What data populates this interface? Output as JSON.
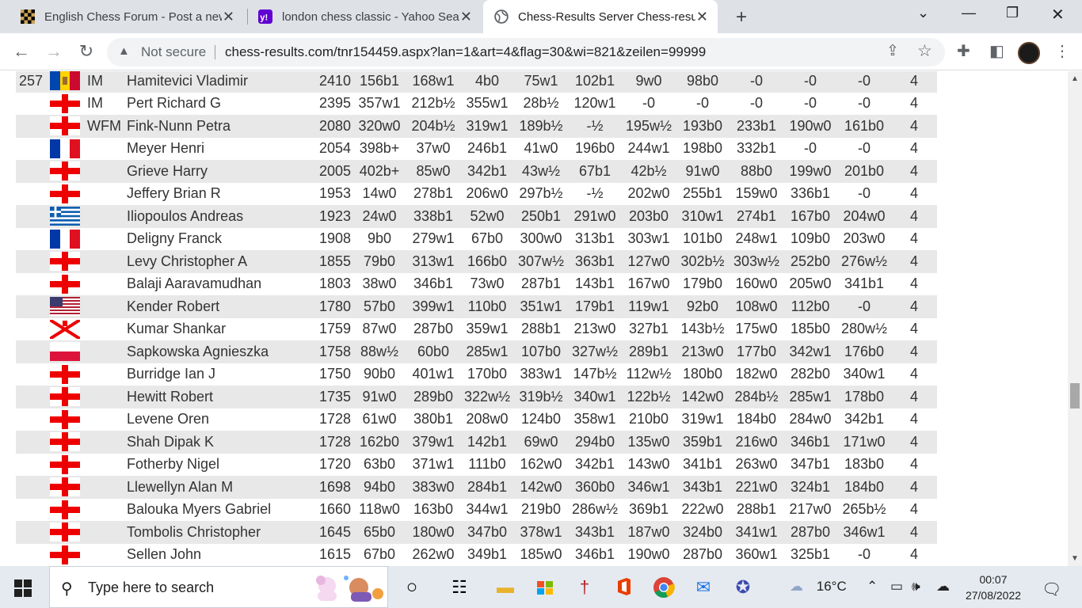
{
  "browser": {
    "tabs": [
      {
        "title": "English Chess Forum - Post a new",
        "favicon": "chessboard-icon"
      },
      {
        "title": "london chess classic - Yahoo Sear",
        "favicon": "yahoo-icon"
      },
      {
        "title": "Chess-Results Server Chess-result",
        "favicon": "globe-icon",
        "active": true
      }
    ],
    "address": {
      "security": "Not secure",
      "url": "chess-results.com/tnr154459.aspx?lan=1&art=4&flag=30&wi=821&zeilen=99999"
    }
  },
  "results": {
    "rows": [
      {
        "rank": "257",
        "flag": "MDA",
        "title": "IM",
        "name": "Hamitevici Vladimir",
        "rating": "2410",
        "rounds": [
          "156b1",
          "168w1",
          "4b0",
          "75w1",
          "102b1",
          "9w0",
          "98b0",
          "-0",
          "-0",
          "-0"
        ],
        "pts": "4"
      },
      {
        "rank": "",
        "flag": "ENG",
        "title": "IM",
        "name": "Pert Richard G",
        "rating": "2395",
        "rounds": [
          "357w1",
          "212b½",
          "355w1",
          "28b½",
          "120w1",
          "-0",
          "-0",
          "-0",
          "-0",
          "-0"
        ],
        "pts": "4"
      },
      {
        "rank": "",
        "flag": "ENG",
        "title": "WFM",
        "name": "Fink-Nunn Petra",
        "rating": "2080",
        "rounds": [
          "320w0",
          "204b½",
          "319w1",
          "189b½",
          "-½",
          "195w½",
          "193b0",
          "233b1",
          "190w0",
          "161b0"
        ],
        "pts": "4"
      },
      {
        "rank": "",
        "flag": "FRA",
        "title": "",
        "name": "Meyer Henri",
        "rating": "2054",
        "rounds": [
          "398b+",
          "37w0",
          "246b1",
          "41w0",
          "196b0",
          "244w1",
          "198b0",
          "332b1",
          "-0",
          "-0"
        ],
        "pts": "4"
      },
      {
        "rank": "",
        "flag": "ENG",
        "title": "",
        "name": "Grieve Harry",
        "rating": "2005",
        "rounds": [
          "402b+",
          "85w0",
          "342b1",
          "43w½",
          "67b1",
          "42b½",
          "91w0",
          "88b0",
          "199w0",
          "201b0"
        ],
        "pts": "4"
      },
      {
        "rank": "",
        "flag": "ENG",
        "title": "",
        "name": "Jeffery Brian R",
        "rating": "1953",
        "rounds": [
          "14w0",
          "278b1",
          "206w0",
          "297b½",
          "-½",
          "202w0",
          "255b1",
          "159w0",
          "336b1",
          "-0"
        ],
        "pts": "4"
      },
      {
        "rank": "",
        "flag": "GRE",
        "title": "",
        "name": "Iliopoulos Andreas",
        "rating": "1923",
        "rounds": [
          "24w0",
          "338b1",
          "52w0",
          "250b1",
          "291w0",
          "203b0",
          "310w1",
          "274b1",
          "167b0",
          "204w0"
        ],
        "pts": "4"
      },
      {
        "rank": "",
        "flag": "FRA",
        "title": "",
        "name": "Deligny Franck",
        "rating": "1908",
        "rounds": [
          "9b0",
          "279w1",
          "67b0",
          "300w0",
          "313b1",
          "303w1",
          "101b0",
          "248w1",
          "109b0",
          "203w0"
        ],
        "pts": "4"
      },
      {
        "rank": "",
        "flag": "ENG",
        "title": "",
        "name": "Levy Christopher A",
        "rating": "1855",
        "rounds": [
          "79b0",
          "313w1",
          "166b0",
          "307w½",
          "363b1",
          "127w0",
          "302b½",
          "303w½",
          "252b0",
          "276w½"
        ],
        "pts": "4"
      },
      {
        "rank": "",
        "flag": "ENG",
        "title": "",
        "name": "Balaji Aaravamudhan",
        "rating": "1803",
        "rounds": [
          "38w0",
          "346b1",
          "73w0",
          "287b1",
          "143b1",
          "167w0",
          "179b0",
          "160w0",
          "205w0",
          "341b1"
        ],
        "pts": "4"
      },
      {
        "rank": "",
        "flag": "USA",
        "title": "",
        "name": "Kender Robert",
        "rating": "1780",
        "rounds": [
          "57b0",
          "399w1",
          "110b0",
          "351w1",
          "179b1",
          "119w1",
          "92b0",
          "108w0",
          "112b0",
          "-0"
        ],
        "pts": "4"
      },
      {
        "rank": "",
        "flag": "JER",
        "title": "",
        "name": "Kumar Shankar",
        "rating": "1759",
        "rounds": [
          "87w0",
          "287b0",
          "359w1",
          "288b1",
          "213w0",
          "327b1",
          "143b½",
          "175w0",
          "185b0",
          "280w½"
        ],
        "pts": "4"
      },
      {
        "rank": "",
        "flag": "POL",
        "title": "",
        "name": "Sapkowska Agnieszka",
        "rating": "1758",
        "rounds": [
          "88w½",
          "60b0",
          "285w1",
          "107b0",
          "327w½",
          "289b1",
          "213w0",
          "177b0",
          "342w1",
          "176b0"
        ],
        "pts": "4"
      },
      {
        "rank": "",
        "flag": "ENG",
        "title": "",
        "name": "Burridge Ian J",
        "rating": "1750",
        "rounds": [
          "90b0",
          "401w1",
          "170b0",
          "383w1",
          "147b½",
          "112w½",
          "180b0",
          "182w0",
          "282b0",
          "340w1"
        ],
        "pts": "4"
      },
      {
        "rank": "",
        "flag": "ENG",
        "title": "",
        "name": "Hewitt Robert",
        "rating": "1735",
        "rounds": [
          "91w0",
          "289b0",
          "322w½",
          "319b½",
          "340w1",
          "122b½",
          "142w0",
          "284b½",
          "285w1",
          "178b0"
        ],
        "pts": "4"
      },
      {
        "rank": "",
        "flag": "ENG",
        "title": "",
        "name": "Levene Oren",
        "rating": "1728",
        "rounds": [
          "61w0",
          "380b1",
          "208w0",
          "124b0",
          "358w1",
          "210b0",
          "319w1",
          "184b0",
          "284w0",
          "342b1"
        ],
        "pts": "4"
      },
      {
        "rank": "",
        "flag": "ENG",
        "title": "",
        "name": "Shah Dipak K",
        "rating": "1728",
        "rounds": [
          "162b0",
          "379w1",
          "142b1",
          "69w0",
          "294b0",
          "135w0",
          "359b1",
          "216w0",
          "346b1",
          "171w0"
        ],
        "pts": "4"
      },
      {
        "rank": "",
        "flag": "ENG",
        "title": "",
        "name": "Fotherby Nigel",
        "rating": "1720",
        "rounds": [
          "63b0",
          "371w1",
          "111b0",
          "162w0",
          "342b1",
          "143w0",
          "341b1",
          "263w0",
          "347b1",
          "183b0"
        ],
        "pts": "4"
      },
      {
        "rank": "",
        "flag": "ENG",
        "title": "",
        "name": "Llewellyn Alan M",
        "rating": "1698",
        "rounds": [
          "94b0",
          "383w0",
          "284b1",
          "142w0",
          "360b0",
          "346w1",
          "343b1",
          "221w0",
          "324b1",
          "184b0"
        ],
        "pts": "4"
      },
      {
        "rank": "",
        "flag": "ENG",
        "title": "",
        "name": "Balouka Myers Gabriel",
        "rating": "1660",
        "rounds": [
          "118w0",
          "163b0",
          "344w1",
          "219b0",
          "286w½",
          "369b1",
          "222w0",
          "288b1",
          "217w0",
          "265b½"
        ],
        "pts": "4"
      },
      {
        "rank": "",
        "flag": "ENG",
        "title": "",
        "name": "Tombolis Christopher",
        "rating": "1645",
        "rounds": [
          "65b0",
          "180w0",
          "347b0",
          "378w1",
          "343b1",
          "187w0",
          "324b0",
          "341w1",
          "287b0",
          "346w1"
        ],
        "pts": "4"
      },
      {
        "rank": "",
        "flag": "ENG",
        "title": "",
        "name": "Sellen John",
        "rating": "1615",
        "rounds": [
          "67b0",
          "262w0",
          "349b1",
          "185w0",
          "346b1",
          "190w0",
          "287b0",
          "360w1",
          "325b1",
          "-0"
        ],
        "pts": "4"
      }
    ]
  },
  "taskbar": {
    "search_placeholder": "Type here to search",
    "weather": "16°C",
    "time": "00:07",
    "date": "27/08/2022"
  }
}
